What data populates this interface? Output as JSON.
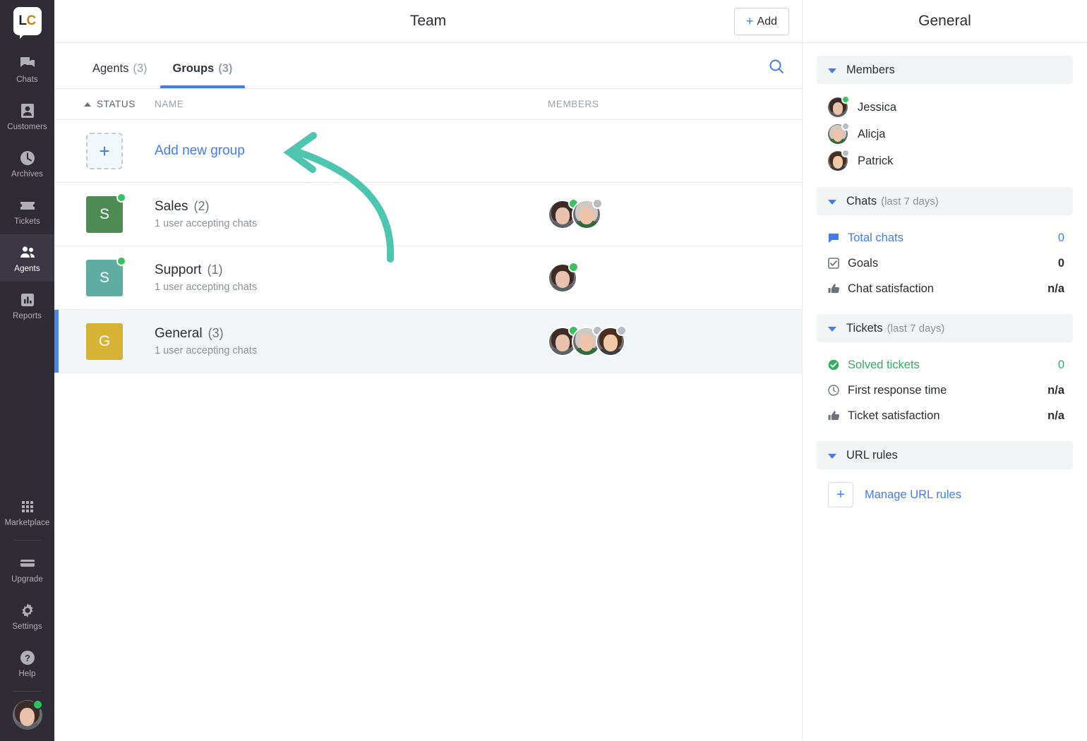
{
  "nav": {
    "logo": {
      "text_left": "L",
      "text_right": "C",
      "name": "livechat-logo"
    },
    "items": [
      {
        "label": "Chats",
        "icon": "chats-icon"
      },
      {
        "label": "Customers",
        "icon": "customers-icon"
      },
      {
        "label": "Archives",
        "icon": "archives-icon"
      },
      {
        "label": "Tickets",
        "icon": "tickets-icon"
      },
      {
        "label": "Agents",
        "icon": "agents-icon",
        "active": true
      },
      {
        "label": "Reports",
        "icon": "reports-icon"
      }
    ],
    "bottom_items": [
      {
        "label": "Marketplace",
        "icon": "marketplace-icon"
      },
      {
        "label": "Upgrade",
        "icon": "upgrade-icon"
      },
      {
        "label": "Settings",
        "icon": "gear-icon"
      },
      {
        "label": "Help",
        "icon": "help-icon"
      }
    ],
    "profile": {
      "name": "current-user-avatar",
      "status": "online"
    }
  },
  "header": {
    "title": "Team",
    "add_button": {
      "plus": "+",
      "label": "Add"
    }
  },
  "tabs": [
    {
      "label": "Agents",
      "count": "(3)",
      "active": false
    },
    {
      "label": "Groups",
      "count": "(3)",
      "active": true
    }
  ],
  "search": {
    "icon": "search-icon"
  },
  "columns": {
    "status": "STATUS",
    "name": "NAME",
    "members": "MEMBERS",
    "sort": "asc"
  },
  "add_row": {
    "tile_plus": "+",
    "link": "Add new group"
  },
  "groups": [
    {
      "initial": "S",
      "color": "#4e8a53",
      "status": "online",
      "name": "Sales",
      "count": "(2)",
      "subtitle": "1 user accepting chats",
      "members": [
        {
          "avatar": "jessica",
          "presence": "online"
        },
        {
          "avatar": "alicja",
          "presence": "offline"
        }
      ]
    },
    {
      "initial": "S",
      "color": "#5eada0",
      "status": "online",
      "name": "Support",
      "count": "(1)",
      "subtitle": "1 user accepting chats",
      "members": [
        {
          "avatar": "jessica",
          "presence": "online"
        }
      ]
    },
    {
      "initial": "G",
      "color": "#d6b335",
      "status": "none",
      "name": "General",
      "count": "(3)",
      "subtitle": "1 user accepting chats",
      "selected": true,
      "members": [
        {
          "avatar": "jessica",
          "presence": "online"
        },
        {
          "avatar": "alicja",
          "presence": "offline"
        },
        {
          "avatar": "patrick",
          "presence": "offline"
        }
      ]
    }
  ],
  "annotation": {
    "type": "curved-arrow",
    "color": "#4ec5ae",
    "points_to": "Add new group"
  },
  "details": {
    "title": "General",
    "sections": [
      {
        "key": "members",
        "title": "Members",
        "subtitle": ""
      },
      {
        "key": "chats",
        "title": "Chats",
        "subtitle": "(last 7 days)"
      },
      {
        "key": "tickets",
        "title": "Tickets",
        "subtitle": "(last 7 days)"
      },
      {
        "key": "url_rules",
        "title": "URL rules",
        "subtitle": ""
      }
    ],
    "members": [
      {
        "name": "Jessica",
        "avatar": "jessica",
        "presence": "online"
      },
      {
        "name": "Alicja",
        "avatar": "alicja",
        "presence": "offline"
      },
      {
        "name": "Patrick",
        "avatar": "patrick",
        "presence": "offline"
      }
    ],
    "chats_stats": [
      {
        "icon": "chat-bubble-icon",
        "label": "Total chats",
        "value": "0",
        "style": "blue"
      },
      {
        "icon": "checkbox-icon",
        "label": "Goals",
        "value": "0",
        "style": "default"
      },
      {
        "icon": "thumbs-up-icon",
        "label": "Chat satisfaction",
        "value": "n/a",
        "style": "default"
      }
    ],
    "tickets_stats": [
      {
        "icon": "check-circle-icon",
        "label": "Solved tickets",
        "value": "0",
        "style": "green"
      },
      {
        "icon": "clock-icon",
        "label": "First response time",
        "value": "n/a",
        "style": "default"
      },
      {
        "icon": "thumbs-up-icon",
        "label": "Ticket satisfaction",
        "value": "n/a",
        "style": "default"
      }
    ],
    "url_rules": {
      "plus": "+",
      "link": "Manage URL rules"
    }
  },
  "colors": {
    "accent_blue": "#3f7cf6",
    "nav_bg": "#2f2c35",
    "online_green": "#37c15f",
    "offline_gray": "#b7bcc1",
    "annotation_teal": "#4ec5ae"
  }
}
